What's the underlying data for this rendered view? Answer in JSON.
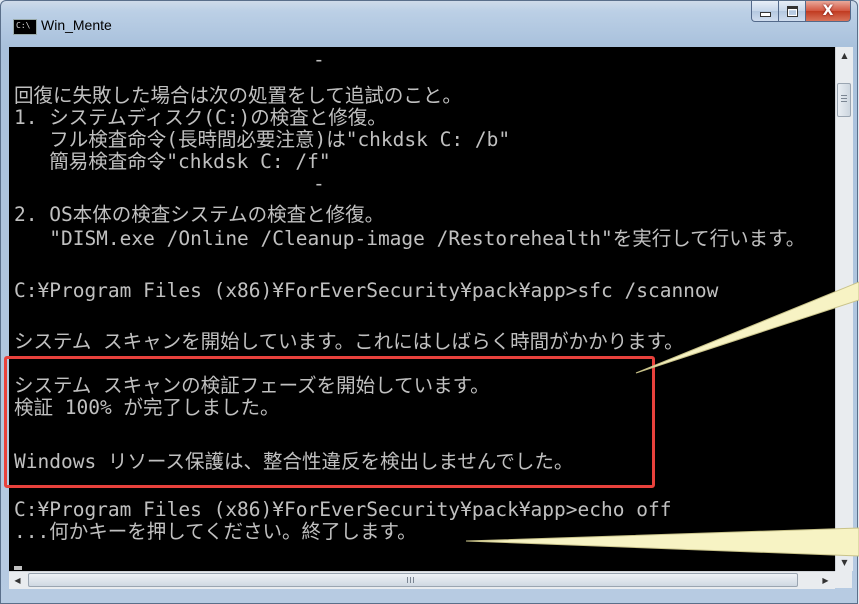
{
  "window": {
    "title": "Win_Mente",
    "icon_label": "C:\\",
    "controls": {
      "minimize": "minimize",
      "maximize": "maximize",
      "close_glyph": "X"
    }
  },
  "console": {
    "lines": [
      "-",
      "回復に失敗した場合は次の処置をして追試のこと。",
      "1. システムディスク(C:)の検査と修復。",
      "   フル検査命令(長時間必要注意)は\"chkdsk C: /b\"",
      "   簡易検査命令\"chkdsk C: /f\"",
      "-",
      "2. OS本体の検査システムの検査と修復。",
      "   \"DISM.exe /Online /Cleanup-image /Restorehealth\"を実行して行います。",
      "",
      "C:¥Program Files (x86)¥ForEverSecurity¥pack¥app>sfc /scannow",
      "",
      "システム スキャンを開始しています。これにはしばらく時間がかかります。",
      "",
      "システム スキャンの検証フェーズを開始しています。",
      "検証 100% が完了しました。",
      "",
      "Windows リソース保護は、整合性違反を検出しませんでした。",
      "",
      "C:¥Program Files (x86)¥ForEverSecurity¥pack¥app>echo off",
      "...何かキーを押してください。終了します。"
    ]
  },
  "scrollbars": {
    "vertical": {
      "up_arrow": "▲",
      "down_arrow": "▼"
    },
    "horizontal": {
      "left_arrow": "◀",
      "right_arrow": "▶",
      "grip": "III"
    }
  },
  "colors": {
    "console_bg": "#000000",
    "console_text": "#c0c0c0",
    "highlight": "#e8413c",
    "callout_fill": "#f7f3c4"
  }
}
